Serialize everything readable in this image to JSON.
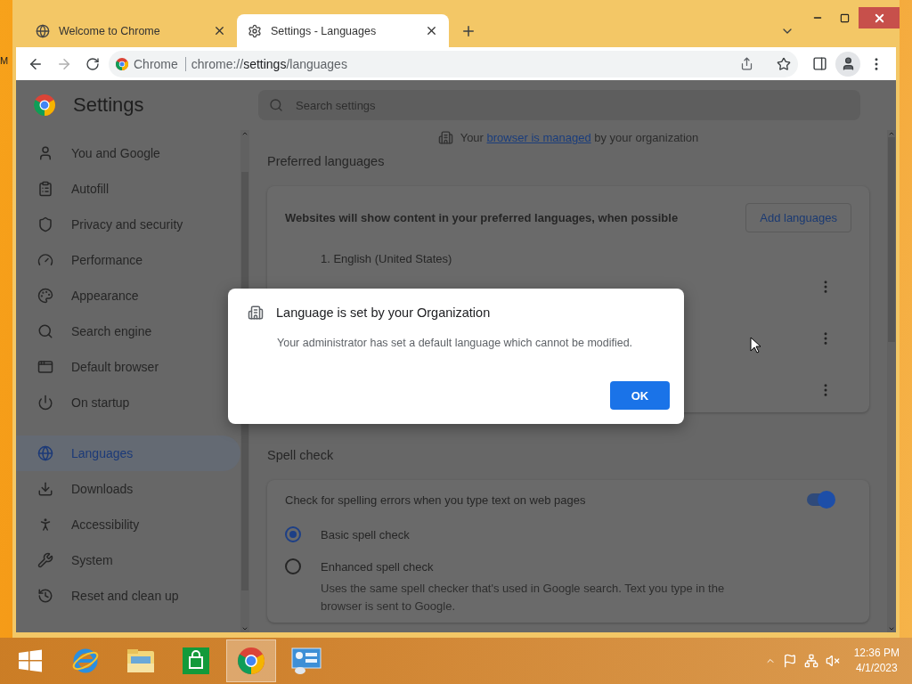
{
  "desktop": {
    "label": "M"
  },
  "tabs": [
    {
      "title": "Welcome to Chrome",
      "selected": false
    },
    {
      "title": "Settings - Languages",
      "selected": true
    }
  ],
  "toolbar": {
    "site_chip": "Chrome",
    "url_host": "chrome://",
    "url_path": "settings",
    "url_rest": "/languages"
  },
  "settings": {
    "title": "Settings",
    "search_placeholder": "Search settings"
  },
  "sidebar": {
    "groups": [
      [
        {
          "label": "You and Google",
          "selected": false
        },
        {
          "label": "Autofill",
          "selected": false
        },
        {
          "label": "Privacy and security",
          "selected": false
        },
        {
          "label": "Performance",
          "selected": false
        },
        {
          "label": "Appearance",
          "selected": false
        },
        {
          "label": "Search engine",
          "selected": false
        },
        {
          "label": "Default browser",
          "selected": false
        },
        {
          "label": "On startup",
          "selected": false
        }
      ],
      [
        {
          "label": "Languages",
          "selected": true
        },
        {
          "label": "Downloads",
          "selected": false
        },
        {
          "label": "Accessibility",
          "selected": false
        },
        {
          "label": "System",
          "selected": false
        },
        {
          "label": "Reset and clean up",
          "selected": false
        }
      ]
    ]
  },
  "managed_notice": {
    "before": "Your",
    "link": "browser is managed",
    "after": "by your organization"
  },
  "preferred_languages": {
    "heading": "Preferred languages",
    "description": "Websites will show content in your preferred languages, when possible",
    "add_button": "Add languages",
    "rows": [
      {
        "kind": "language",
        "label": "1. English (United States)"
      },
      {
        "kind": "covered"
      },
      {
        "kind": "covered"
      }
    ]
  },
  "spell_check": {
    "heading": "Spell check",
    "toggle_label": "Check for spelling errors when you type text on web pages",
    "on": true,
    "options": [
      {
        "label": "Basic spell check",
        "selected": true
      },
      {
        "label": "Enhanced spell check",
        "description": "Uses the same spell checker that's used in Google search. Text you type in the browser is sent to Google.",
        "selected": false
      }
    ]
  },
  "dialog": {
    "title": "Language is set by your Organization",
    "message": "Your administrator has set a default language which cannot be modified.",
    "ok_button": "OK"
  },
  "taskbar": {
    "time": "12:36 PM",
    "date": "4/1/2023",
    "pinned": [
      {
        "selected": false
      },
      {
        "selected": false
      },
      {
        "selected": false
      },
      {
        "selected": true
      },
      {
        "selected": false
      }
    ]
  }
}
